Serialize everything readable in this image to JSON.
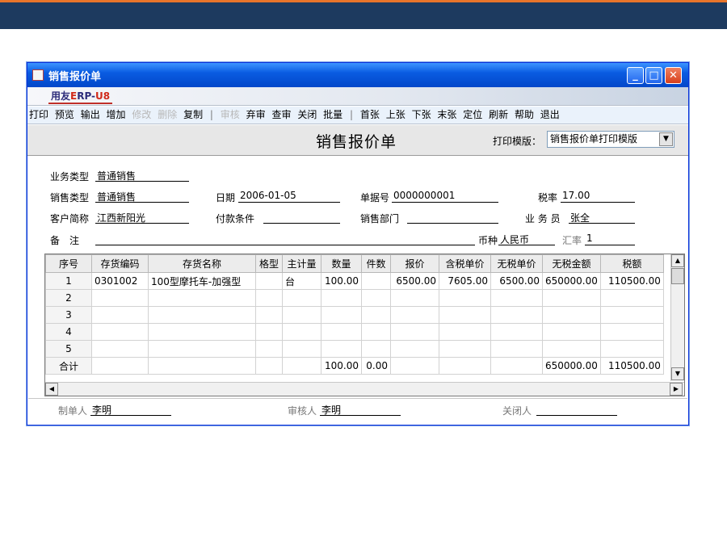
{
  "window": {
    "title": "销售报价单",
    "banner_logo_a": "用友",
    "banner_logo_b": "E",
    "banner_logo_c": "RP-",
    "banner_logo_d": "U8"
  },
  "toolbar": {
    "print": "打印",
    "preview": "预览",
    "export": "输出",
    "add": "增加",
    "modify": "修改",
    "delete": "删除",
    "copy": "复制",
    "sep": "|",
    "audit": "审核",
    "unaudit": "弃审",
    "check": "查审",
    "close": "关闭",
    "batch": "批量",
    "first": "首张",
    "prev": "上张",
    "next": "下张",
    "last": "末张",
    "locate": "定位",
    "refresh": "刷新",
    "help": "帮助",
    "exit": "退出"
  },
  "form": {
    "title": "销售报价单",
    "template_label": "打印模版：",
    "template_value": "销售报价单打印模版"
  },
  "fields": {
    "biz_type_label": "业务类型",
    "biz_type": "普通销售",
    "sale_type_label": "销售类型",
    "sale_type": "普通销售",
    "date_label": "日期",
    "date": "2006-01-05",
    "doc_no_label": "单据号",
    "doc_no": "0000000001",
    "tax_rate_label": "税率",
    "tax_rate": "17.00",
    "customer_label": "客户简称",
    "customer": "江西新阳光",
    "payment_label": "付款条件",
    "payment": "",
    "dept_label": "销售部门",
    "dept": "",
    "salesman_label": "业 务 员",
    "salesman": "张全",
    "remark_label": "备　注",
    "remark": "",
    "currency_label": "币种",
    "currency": "人民币",
    "rate_label": "汇率",
    "rate": "1"
  },
  "grid": {
    "columns": [
      "序号",
      "存货编码",
      "存货名称",
      "格型",
      "主计量",
      "数量",
      "件数",
      "报价",
      "含税单价",
      "无税单价",
      "无税金额",
      "税额"
    ],
    "rows": [
      [
        "1",
        "0301002",
        "100型摩托车-加强型",
        "",
        "台",
        "100.00",
        "",
        "6500.00",
        "7605.00",
        "6500.00",
        "650000.00",
        "110500.00"
      ],
      [
        "2",
        "",
        "",
        "",
        "",
        "",
        "",
        "",
        "",
        "",
        "",
        ""
      ],
      [
        "3",
        "",
        "",
        "",
        "",
        "",
        "",
        "",
        "",
        "",
        "",
        ""
      ],
      [
        "4",
        "",
        "",
        "",
        "",
        "",
        "",
        "",
        "",
        "",
        "",
        ""
      ],
      [
        "5",
        "",
        "",
        "",
        "",
        "",
        "",
        "",
        "",
        "",
        "",
        ""
      ],
      [
        "合计",
        "",
        "",
        "",
        "",
        "100.00",
        "0.00",
        "",
        "",
        "",
        "650000.00",
        "110500.00"
      ]
    ]
  },
  "footer": {
    "maker_label": "制单人",
    "maker": "李明",
    "auditor_label": "审核人",
    "auditor": "李明",
    "closer_label": "关闭人",
    "closer": ""
  },
  "colors": {
    "title_bar": "#0a5ce2",
    "header_bg": "#e7e7e7",
    "accent_top": "#1d3a5f",
    "accent_stripe": "#e8742a"
  }
}
